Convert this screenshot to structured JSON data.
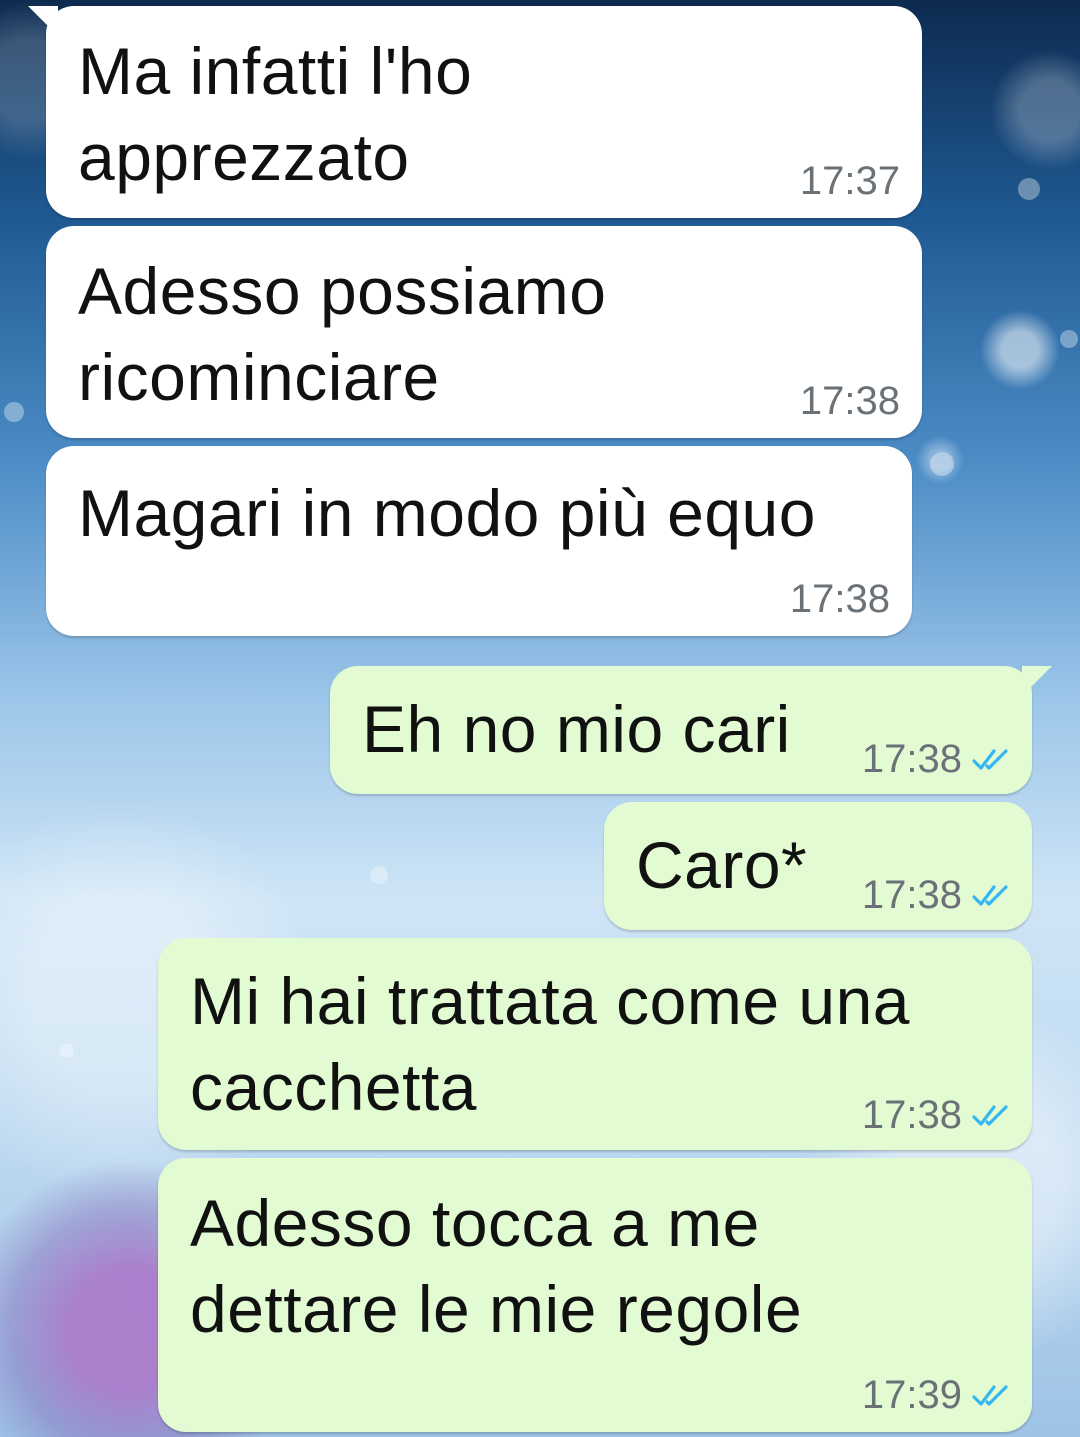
{
  "messages": [
    {
      "text": "Ma infatti l'ho\napprezzato",
      "time": "17:37",
      "direction": "incoming"
    },
    {
      "text": "Adesso possiamo\nricominciare",
      "time": "17:38",
      "direction": "incoming"
    },
    {
      "text": "Magari in modo più equo",
      "time": "17:38",
      "direction": "incoming"
    },
    {
      "text": "Eh no mio cari",
      "time": "17:38",
      "direction": "outgoing",
      "status": "read"
    },
    {
      "text": "Caro*",
      "time": "17:38",
      "direction": "outgoing",
      "status": "read"
    },
    {
      "text": "Mi hai trattata come una\ncacchetta",
      "time": "17:38",
      "direction": "outgoing",
      "status": "read"
    },
    {
      "text": "Adesso tocca a me\ndettare le mie regole",
      "time": "17:39",
      "direction": "outgoing",
      "status": "read"
    }
  ],
  "colors": {
    "incoming_bubble": "#ffffff",
    "outgoing_bubble": "#e2fbd2",
    "read_check": "#34b7f1",
    "timestamp": "#6b7277"
  },
  "icons": {
    "read_receipt": "double-check-icon"
  }
}
